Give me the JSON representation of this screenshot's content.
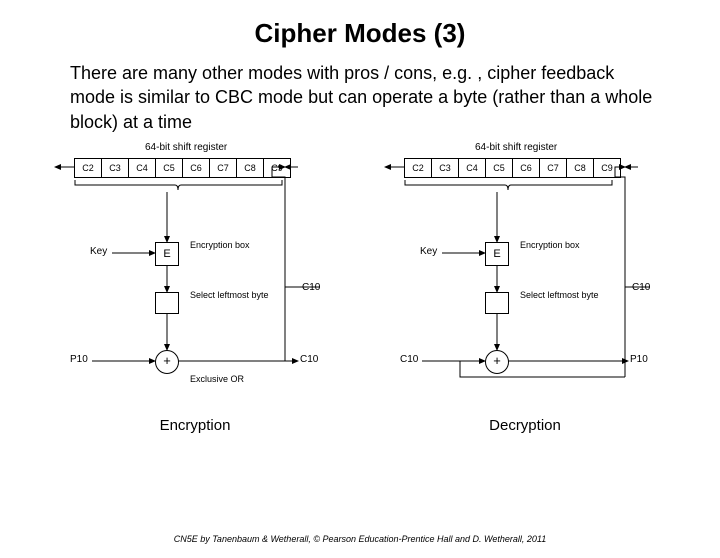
{
  "title": "Cipher Modes (3)",
  "body": "There are many other modes with pros / cons, e.g. , cipher feedback mode is similar to CBC mode but can operate a byte (rather than a whole block) at a time",
  "shift_label": "64-bit shift register",
  "cells": [
    "C2",
    "C3",
    "C4",
    "C5",
    "C6",
    "C7",
    "C8",
    "C9"
  ],
  "key_label": "Key",
  "e_label": "E",
  "enc_box_label": "Encryption box",
  "select_label": "Select leftmost byte",
  "xor_symbol": "+",
  "xor_label": "Exclusive OR",
  "c10": "C10",
  "enc": {
    "p": "P10",
    "out": "C10",
    "caption": "Encryption"
  },
  "dec": {
    "in": "C10",
    "p": "P10",
    "caption": "Decryption"
  },
  "footer": "CN5E by Tanenbaum & Wetherall, © Pearson Education-Prentice Hall and D. Wetherall, 2011"
}
